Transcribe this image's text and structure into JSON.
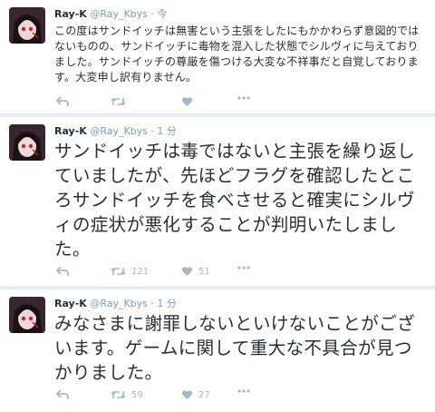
{
  "tweets": [
    {
      "name": "Ray-K",
      "handle": "@Ray_Kbys",
      "time": "· 今",
      "text": "この度はサンドイッチは無害という主張をしたにもかかわらず意図的ではないものの、サンドイッチに毒物を混入した状態でシルヴィに与えておりました。サンドイッチの尊厳を傷つける大変な不祥事だと自覚しております。大変申し訳有りません。",
      "retweets": "",
      "likes": ""
    },
    {
      "name": "Ray-K",
      "handle": "@Ray_Kbys",
      "time": "· 1 分",
      "text": "サンドイッチは毒ではないと主張を繰り返していましたが、先ほどフラグを確認したところサンドイッチを食べさせると確実にシルヴィの症状が悪化することが判明いたしました。",
      "retweets": "121",
      "likes": "51"
    },
    {
      "name": "Ray-K",
      "handle": "@Ray_Kbys",
      "time": "· 1 分",
      "text": "みなさまに謝罪しないといけないことがございます。ゲームに関して重大な不具合が見つかりました。",
      "retweets": "59",
      "likes": "27"
    }
  ],
  "icons": [
    "reply-icon",
    "retweet-icon",
    "like-icon",
    "more-icon"
  ],
  "colors": {
    "background": "#e6ecf0",
    "card": "#ffffff",
    "text": "#292f33",
    "muted": "#8899a6",
    "icon": "#aab8c2"
  }
}
